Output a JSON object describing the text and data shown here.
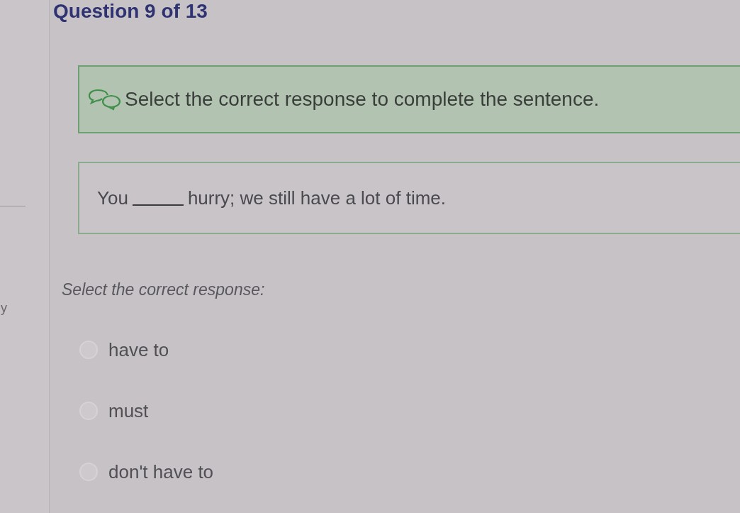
{
  "header": {
    "title": "Question 9 of 13"
  },
  "side_panel": {
    "text_fragment": "y"
  },
  "instruction_banner": {
    "text": "Select the correct response to complete the sentence."
  },
  "sentence": {
    "before_blank": "You",
    "after_blank": "hurry; we still have a lot of time."
  },
  "prompt": "Select the correct response:",
  "options": [
    {
      "label": "have to",
      "selected": false
    },
    {
      "label": "must",
      "selected": false
    },
    {
      "label": "don't have to",
      "selected": false
    }
  ]
}
